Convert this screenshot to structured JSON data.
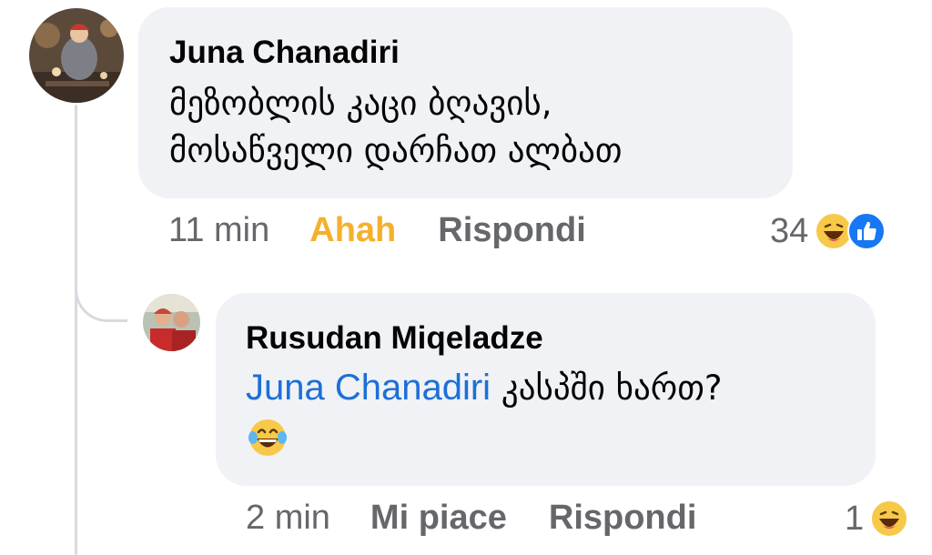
{
  "comments": [
    {
      "author": "Juna Chanadiri",
      "text_lines": [
        "მეზობლის კაცი ბღავის,",
        "მოსაწველი დარჩათ ალბათ"
      ],
      "time": "11 min",
      "reaction_action": "Ahah",
      "reply_label": "Rispondi",
      "reaction_count": "34",
      "reaction_icons": [
        "haha-icon",
        "like-icon"
      ],
      "colors": {
        "reaction_action": "#f5b02c"
      }
    },
    {
      "author": "Rusudan Miqeladze",
      "mention": "Juna Chanadiri",
      "text": "კასპში ხართ?",
      "emoji": "laughing-tears-emoji",
      "time": "2 min",
      "reaction_action": "Mi piace",
      "reply_label": "Rispondi",
      "reaction_count": "1",
      "reaction_icons": [
        "haha-icon"
      ]
    }
  ],
  "colors": {
    "bubble_bg": "#f0f2f5",
    "mention": "#1c6fd8",
    "meta_text": "#65676b",
    "like_blue": "#1877f2"
  }
}
